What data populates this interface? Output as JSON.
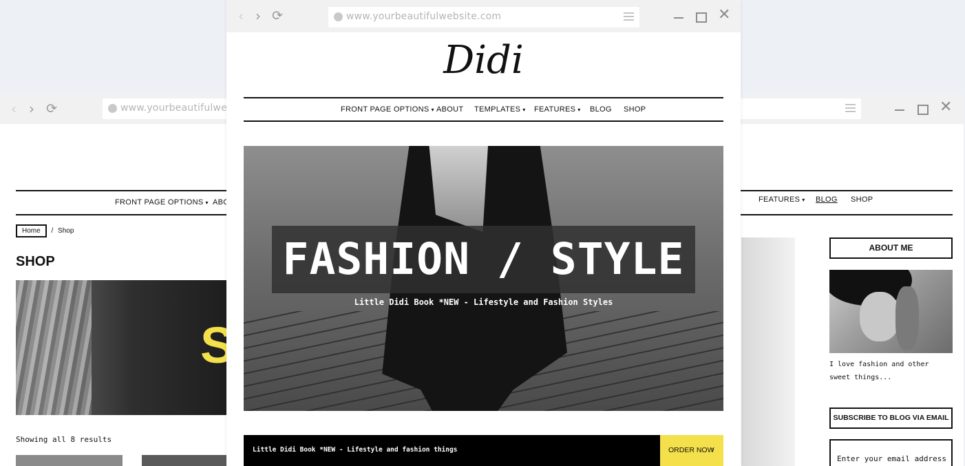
{
  "back_window": {
    "url": "www.yourbeautifulwebsite.com",
    "nav": [
      "FRONT PAGE OPTIONS",
      "ABOUT"
    ],
    "nav_right": [
      "FEATURES",
      "BLOG",
      "SHOP"
    ],
    "breadcrumb": {
      "home": "Home",
      "separator": "/",
      "current": "Shop"
    },
    "heading": "SHOP",
    "banner_letter": "S",
    "results": "Showing all 8 results",
    "sidebar": {
      "about_title": "ABOUT ME",
      "bio": "I love fashion and other sweet things...",
      "subscribe_title": "SUBSCRIBE TO BLOG VIA EMAIL",
      "email_placeholder": "Enter your email address"
    }
  },
  "front_window": {
    "url": "www.yourbeautifulwebsite.com",
    "logo": "Didi",
    "nav": [
      {
        "label": "FRONT PAGE OPTIONS",
        "dropdown": true
      },
      {
        "label": "ABOUT",
        "dropdown": false
      },
      {
        "label": "TEMPLATES",
        "dropdown": true
      },
      {
        "label": "FEATURES",
        "dropdown": true
      },
      {
        "label": "BLOG",
        "dropdown": false
      },
      {
        "label": "SHOP",
        "dropdown": false
      }
    ],
    "hero": {
      "title": "FASHION / STYLE",
      "subtitle": "Little Didi Book *NEW - Lifestyle and Fashion Styles"
    },
    "promo": {
      "text": "Little Didi Book *NEW - Lifestyle and fashion things",
      "button": "ORDER NOW",
      "arrow": "›"
    }
  },
  "colors": {
    "accent_yellow": "#f4e04a",
    "text": "#111111",
    "page_bg": "#edf1f6"
  },
  "icons": [
    "back-arrow-icon",
    "forward-arrow-icon",
    "reload-icon",
    "globe-icon",
    "hamburger-menu-icon",
    "minimize-icon",
    "maximize-icon",
    "close-icon",
    "dropdown-caret-icon"
  ]
}
